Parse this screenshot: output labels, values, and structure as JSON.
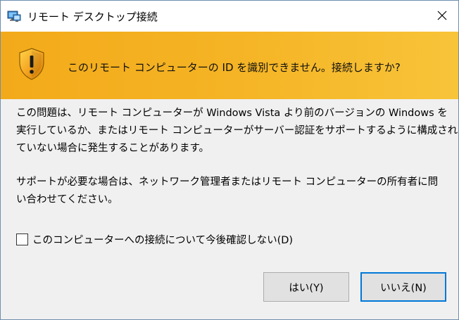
{
  "window": {
    "title": "リモート デスクトップ接続",
    "app_icon": "remote-desktop-icon",
    "close_icon": "close-icon"
  },
  "banner": {
    "icon": "warning-shield-icon",
    "message": "このリモート コンピューターの ID を識別できません。接続しますか?",
    "colors": {
      "start": "#f3aa1a",
      "end": "#f8c43a"
    }
  },
  "body": {
    "paragraph1": [
      "この問題は、リモート コンピューターが Windows Vista より前のバージョンの Windows を",
      "実行しているか、またはリモート コンピューターがサーバー認証をサポートするように構成され",
      "ていない場合に発生することがあります。"
    ],
    "paragraph2": [
      "サポートが必要な場合は、ネットワーク管理者またはリモート コンピューターの所有者に問",
      "い合わせてください。"
    ]
  },
  "checkbox": {
    "label": "このコンピューターへの接続について今後確認しない(D)",
    "checked": false
  },
  "buttons": {
    "yes": "はい(Y)",
    "no": "いいえ(N)",
    "focus_color": "#0078d7"
  }
}
